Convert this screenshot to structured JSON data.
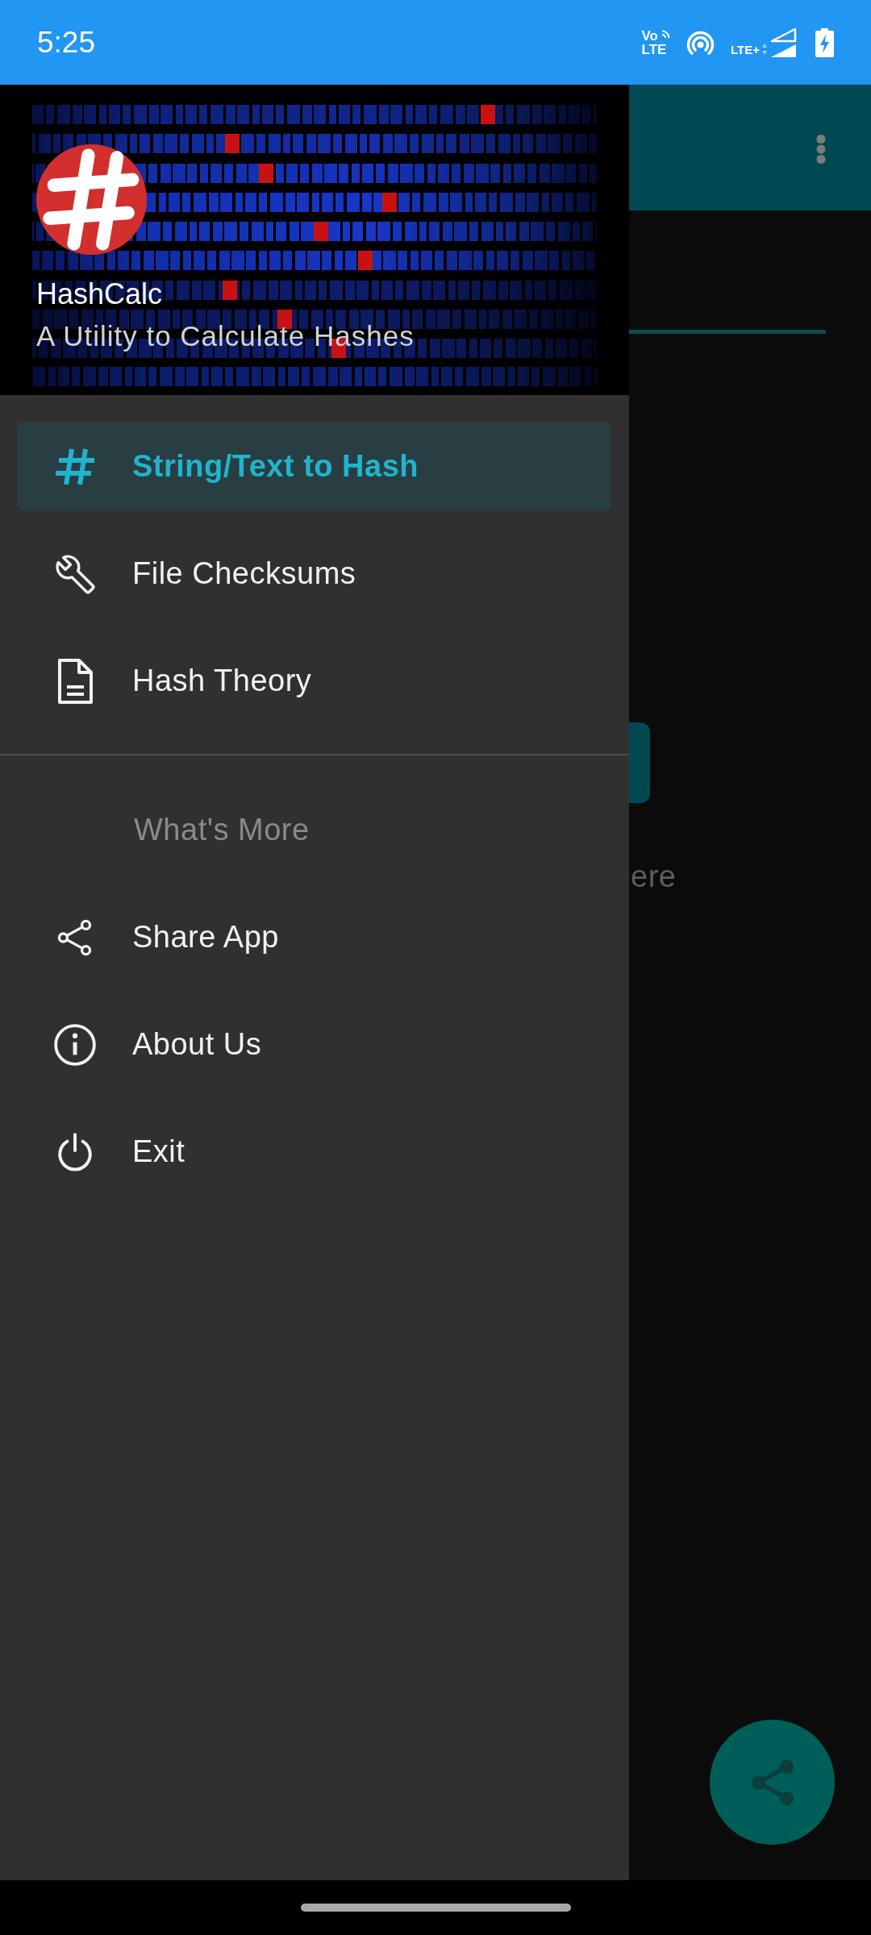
{
  "status_bar": {
    "time": "5:25",
    "volte": [
      "Vo",
      "LTE"
    ],
    "network": "LTE+"
  },
  "drawer": {
    "header": {
      "title": "HashCalc",
      "subtitle": "A Utility to Calculate Hashes"
    },
    "items": [
      {
        "label": "String/Text to Hash",
        "selected": true
      },
      {
        "label": "File Checksums",
        "selected": false
      },
      {
        "label": "Hash Theory",
        "selected": false
      }
    ],
    "section": {
      "heading": "What's More",
      "items": [
        {
          "label": "Share App",
          "selected": false
        },
        {
          "label": "About Us",
          "selected": false
        },
        {
          "label": "Exit",
          "selected": false
        }
      ]
    }
  },
  "content": {
    "hint_fragment": "ere"
  }
}
